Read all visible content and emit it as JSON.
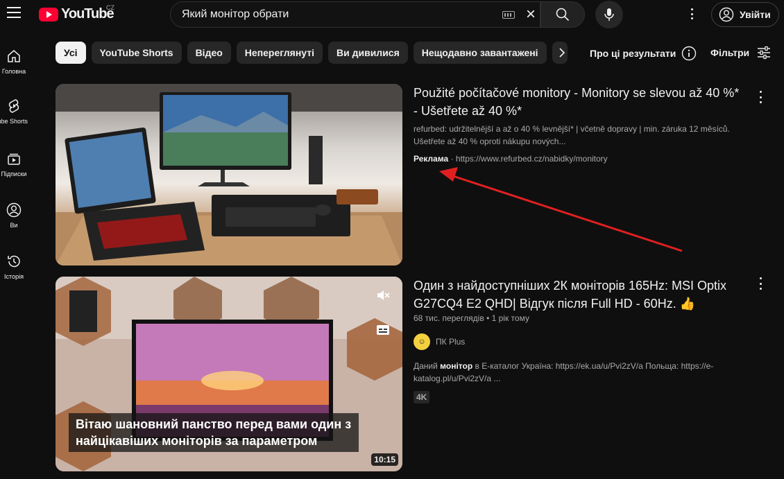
{
  "header": {
    "logo_text": "YouTube",
    "country_code": "CZ",
    "search_value": "Який монітор обрати",
    "signin_label": "Увійти"
  },
  "sidebar": {
    "items": [
      {
        "label": "Головна",
        "icon": "home-icon"
      },
      {
        "label": "YouTube Shorts",
        "icon": "shorts-icon"
      },
      {
        "label": "Підписки",
        "icon": "subscriptions-icon"
      },
      {
        "label": "Ви",
        "icon": "you-icon"
      },
      {
        "label": "Історія",
        "icon": "history-icon"
      }
    ]
  },
  "chips": [
    "Усі",
    "YouTube Shorts",
    "Відео",
    "Непереглянуті",
    "Ви дивилися",
    "Нещодавно завантажені"
  ],
  "about_label": "Про ці результати",
  "filters_label": "Фільтри",
  "results": [
    {
      "type": "ad",
      "title": "Použité počítačové monitory - Monitory se slevou až 40 %* - Ušetřete až 40 %*",
      "description": "refurbed: udržitelnější a až o 40 % levnější* | včetně dopravy | min. záruka 12 měsíců. Ušetřete až 40 % oproti nákupu nových...",
      "ad_label": "Реклама",
      "separator": " · ",
      "url": "https://www.refurbed.cz/nabidky/monitory"
    },
    {
      "type": "video",
      "title": "Один з найдоступніших 2К моніторів 165Hz: MSI Optix G27CQ4 E2 QHD| Відгук після Full HD - 60Hz. 👍",
      "views": "68 тис. переглядів",
      "age": "1 рік тому",
      "meta_separator": " • ",
      "channel": "ПК Plus",
      "description_pre": "Даний ",
      "description_bold": "монітор",
      "description_post": " в E-каталог Україна: https://ek.ua/u/Pvi2zV/a Польща: https://e-katalog.pl/u/Pvi2zV/a ...",
      "badge": "4K",
      "duration": "10:15",
      "caption": "Вітаю шановний панство перед вами один з найцікавіших моніторів за параметром"
    }
  ],
  "colors": {
    "background": "#0f0f0f",
    "logo_red": "#ff0033",
    "arrow_red": "#e02020"
  }
}
